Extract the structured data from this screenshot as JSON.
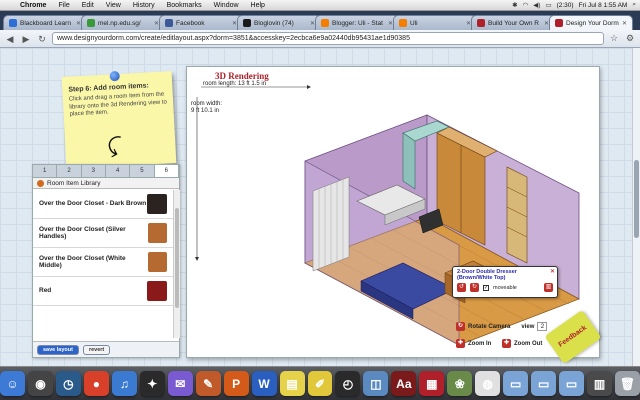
{
  "menubar": {
    "app": "Chrome",
    "items": [
      "File",
      "Edit",
      "View",
      "History",
      "Bookmarks",
      "Window",
      "Help"
    ],
    "battery": "(2:30)",
    "clock": "Fri Jul 8  1:55 AM"
  },
  "tabs": [
    {
      "title": "Blackboard Learn",
      "color": "#2b6fd6"
    },
    {
      "title": "mel.np.edu.sg/",
      "color": "#3a9a3a"
    },
    {
      "title": "Facebook",
      "color": "#3b5998"
    },
    {
      "title": "Bloglovin (74)",
      "color": "#1a1a1a"
    },
    {
      "title": "Blogger: Uli - Stat",
      "color": "#f57d00"
    },
    {
      "title": "Uli",
      "color": "#f57d00"
    },
    {
      "title": "Build Your Own R",
      "color": "#b0202a"
    },
    {
      "title": "Design Your Dorm",
      "color": "#b0202a"
    }
  ],
  "address": {
    "url": "www.designyourdorm.com/create/editlayout.aspx?dorm=3851&accesskey=2ecbca6e9a02440db95431ae1d90385"
  },
  "note": {
    "title": "Step 6: Add room items:",
    "body": "Click and drag a room item from the library onto the 3d Rendering view to place the item."
  },
  "library": {
    "tabs": [
      "1",
      "2",
      "3",
      "4",
      "5",
      "6"
    ],
    "active_tab": 5,
    "title": "Room Item Library",
    "items": [
      {
        "label": "Over the Door Closet - Dark Brown",
        "color": "#2a2320"
      },
      {
        "label": "Over the Door Closet (Silver Handles)",
        "color": "#b56a32"
      },
      {
        "label": "Over the Door Closet (White Middle)",
        "color": "#b56a32"
      },
      {
        "label": "Red",
        "color": "#8a1a1a"
      }
    ],
    "save_label": "save layout",
    "revert_label": "revert"
  },
  "render": {
    "title": "3D Rendering",
    "room_length": "room length:  13 ft 1.5 in",
    "room_width_label": "room width:",
    "room_width_value": "9 ft 10.1 in"
  },
  "popup": {
    "title": "2-Door Double Dresser (Brown/White Top)",
    "moveable_label": "moveable",
    "moveable_checked": true
  },
  "camera": {
    "rotate_label": "Rotate Camera",
    "view_label": "view",
    "view_value": "2",
    "zoom_in_label": "Zoom In",
    "zoom_out_label": "Zoom Out"
  },
  "feedback_label": "Feedback",
  "dock": [
    {
      "name": "finder-icon",
      "color": "#3d7ad6",
      "glyph": "☺"
    },
    {
      "name": "dashboard-icon",
      "color": "#444",
      "glyph": "◉"
    },
    {
      "name": "time-machine-icon",
      "color": "#2a5a8a",
      "glyph": "◷"
    },
    {
      "name": "chrome-icon",
      "color": "#d9402a",
      "glyph": "●"
    },
    {
      "name": "itunes-icon",
      "color": "#3a7ad0",
      "glyph": "♫"
    },
    {
      "name": "twitter-bird-icon",
      "color": "#2a2a2a",
      "glyph": "✦"
    },
    {
      "name": "stamps-icon",
      "color": "#7a5ad0",
      "glyph": "✉"
    },
    {
      "name": "photoshop-icon",
      "color": "#c05a2a",
      "glyph": "✎"
    },
    {
      "name": "powerpoint-icon",
      "color": "#d45a1a",
      "glyph": "P"
    },
    {
      "name": "word-icon",
      "color": "#2a5fbf",
      "glyph": "W"
    },
    {
      "name": "stickies-icon",
      "color": "#e6d24a",
      "glyph": "▤"
    },
    {
      "name": "notes-icon",
      "color": "#e0c83a",
      "glyph": "✐"
    },
    {
      "name": "clock-icon",
      "color": "#2a2a2a",
      "glyph": "◴"
    },
    {
      "name": "preview-icon",
      "color": "#5a8abf",
      "glyph": "◫"
    },
    {
      "name": "dictionary-icon",
      "color": "#7a1a1a",
      "glyph": "Aa"
    },
    {
      "name": "photo-booth-icon",
      "color": "#b0202a",
      "glyph": "▦"
    },
    {
      "name": "iphoto-icon",
      "color": "#6a8a4a",
      "glyph": "❀"
    },
    {
      "name": "picasa-icon",
      "color": "#e0e0e0",
      "glyph": "◍"
    },
    {
      "name": "applications-folder-icon",
      "color": "#7aa4d6",
      "glyph": "▭"
    },
    {
      "name": "documents-folder-icon",
      "color": "#7aa4d6",
      "glyph": "▭"
    },
    {
      "name": "downloads-folder-icon",
      "color": "#7aa4d6",
      "glyph": "▭"
    },
    {
      "name": "stack-icon",
      "color": "#4a4a4a",
      "glyph": "▥"
    },
    {
      "name": "trash-icon",
      "color": "#9aa0a8",
      "glyph": "🗑"
    }
  ]
}
